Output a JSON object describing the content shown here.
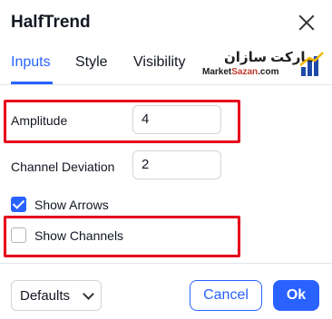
{
  "dialog": {
    "title": "HalfTrend"
  },
  "tabs": [
    {
      "label": "Inputs",
      "active": true
    },
    {
      "label": "Style",
      "active": false
    },
    {
      "label": "Visibility",
      "active": false
    }
  ],
  "logo": {
    "text_fa": "مارکت سازان",
    "text_en_a": "Market",
    "text_en_b": "Sazan",
    "text_en_c": ".com"
  },
  "inputs": {
    "amplitude": {
      "label": "Amplitude",
      "value": "4"
    },
    "channel_deviation": {
      "label": "Channel Deviation",
      "value": "2"
    }
  },
  "checkboxes": {
    "show_arrows": {
      "label": "Show Arrows",
      "checked": true
    },
    "show_channels": {
      "label": "Show Channels",
      "checked": false
    }
  },
  "footer": {
    "defaults_label": "Defaults",
    "cancel_label": "Cancel",
    "ok_label": "Ok"
  },
  "colors": {
    "accent": "#2962ff",
    "highlight": "#e5001b"
  }
}
